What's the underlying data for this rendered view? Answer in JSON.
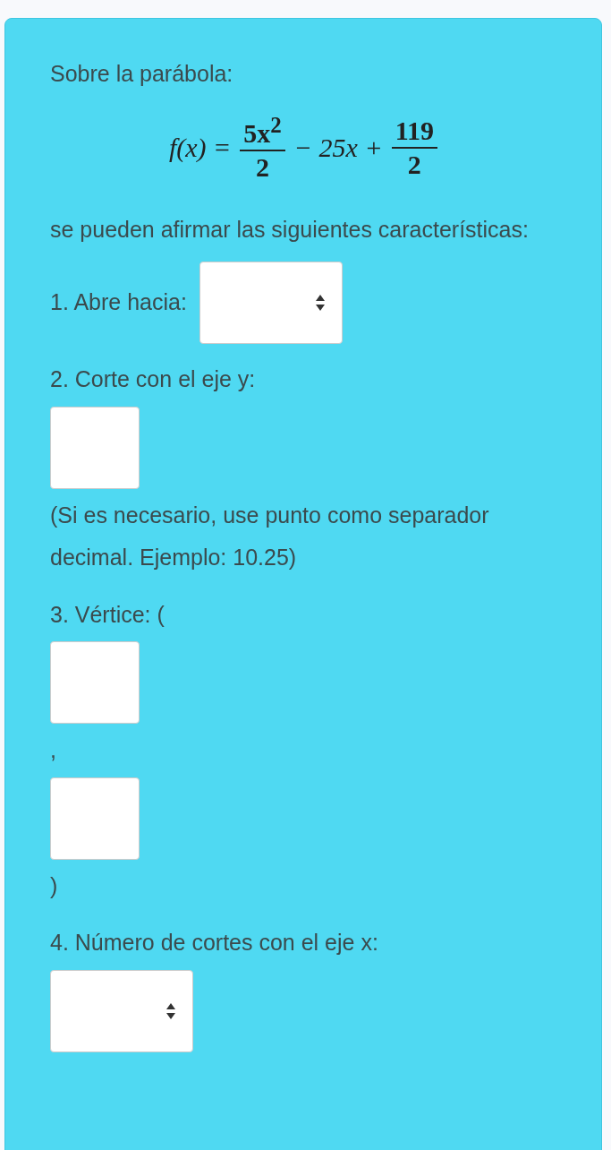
{
  "intro": "Sobre la parábola:",
  "formula": [
    {
      "kind": "text",
      "text": "f(x) ="
    },
    {
      "kind": "fraction",
      "numerator": "5x$^{2}$",
      "denominator": "2"
    },
    {
      "kind": "text",
      "text": "− 25x +"
    },
    {
      "kind": "fraction",
      "numerator": "119",
      "denominator": "2"
    }
  ],
  "lead": "se pueden afirmar las siguientes características:",
  "questions": [
    {
      "lines": [
        [
          {
            "kind": "label",
            "text": "1. Abre hacia:"
          },
          {
            "kind": "select"
          }
        ]
      ]
    },
    {
      "lines": [
        [
          {
            "kind": "label",
            "text": "2. Corte con el eje y:"
          }
        ],
        [
          {
            "kind": "input"
          }
        ],
        [
          {
            "kind": "note",
            "text": "(Si es necesario, use punto como separador decimal. Ejemplo: 10.25)"
          }
        ]
      ]
    },
    {
      "lines": [
        [
          {
            "kind": "label",
            "text": "3. Vértice: ("
          }
        ],
        [
          {
            "kind": "input"
          }
        ],
        [
          {
            "kind": "label",
            "text": ","
          }
        ],
        [
          {
            "kind": "input"
          }
        ],
        [
          {
            "kind": "label",
            "text": ")"
          }
        ]
      ]
    },
    {
      "lines": [
        [
          {
            "kind": "label",
            "text": "4. Número de cortes con el eje x:"
          }
        ],
        [
          {
            "kind": "select"
          }
        ]
      ]
    }
  ]
}
